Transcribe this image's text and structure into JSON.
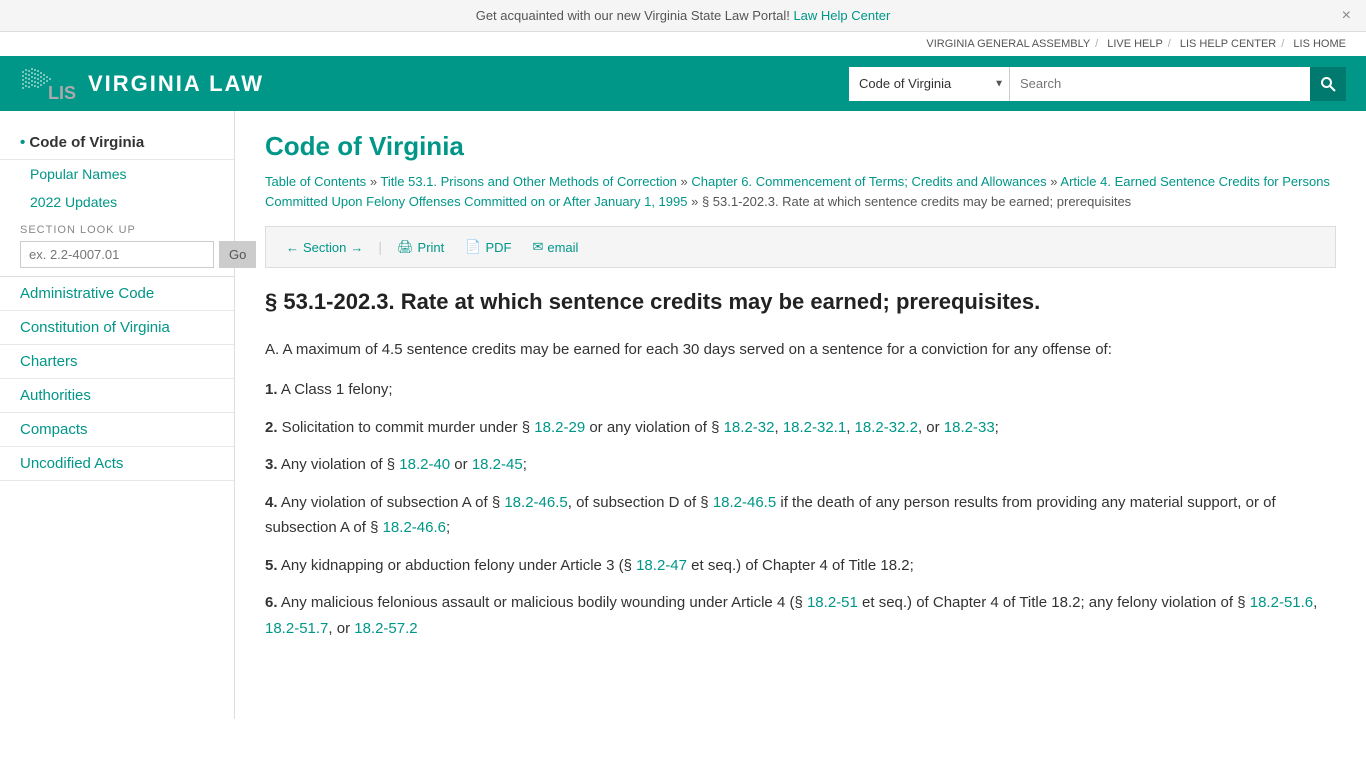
{
  "banner": {
    "text": "Get acquainted with our new Virginia State Law Portal!",
    "link_label": "Law Help Center",
    "link_href": "#",
    "close_label": "×"
  },
  "top_nav": {
    "items": [
      {
        "label": "VIRGINIA GENERAL ASSEMBLY",
        "href": "#"
      },
      {
        "label": "LIVE HELP",
        "href": "#"
      },
      {
        "label": "LIS HELP CENTER",
        "href": "#"
      },
      {
        "label": "LIS HOME",
        "href": "#"
      }
    ]
  },
  "header": {
    "site_title": "VIRGINIA LAW",
    "search_dropdown_value": "Code of Virginia",
    "search_dropdown_options": [
      "Code of Virginia",
      "Administrative Code",
      "Constitution of Virginia",
      "Charters",
      "Authorities",
      "Compacts",
      "Uncodified Acts"
    ],
    "search_placeholder": "Search"
  },
  "sidebar": {
    "items": [
      {
        "label": "Code of Virginia",
        "active": true,
        "href": "#"
      },
      {
        "label": "Popular Names",
        "sub": true,
        "href": "#"
      },
      {
        "label": "2022 Updates",
        "sub": true,
        "href": "#"
      },
      {
        "label": "Administrative Code",
        "href": "#"
      },
      {
        "label": "Constitution of Virginia",
        "href": "#"
      },
      {
        "label": "Charters",
        "href": "#"
      },
      {
        "label": "Authorities",
        "href": "#"
      },
      {
        "label": "Compacts",
        "href": "#"
      },
      {
        "label": "Uncodified Acts",
        "href": "#"
      }
    ],
    "section_lookup": {
      "label": "SECTION LOOK UP",
      "placeholder": "ex. 2.2-4007.01",
      "button_label": "Go"
    }
  },
  "main": {
    "heading": "Code of Virginia",
    "breadcrumb": [
      {
        "label": "Table of Contents",
        "href": "#"
      },
      {
        "label": "Title 53.1. Prisons and Other Methods of Correction",
        "href": "#"
      },
      {
        "label": "Chapter 6. Commencement of Terms; Credits and Allowances",
        "href": "#"
      },
      {
        "label": "Article 4. Earned Sentence Credits for Persons Committed Upon Felony Offenses Committed on or After January 1, 1995",
        "href": "#"
      },
      {
        "label": "§ 53.1-202.3. Rate at which sentence credits may be earned; prerequisites",
        "href": "#"
      }
    ],
    "toolbar": {
      "section_label": "Section",
      "print_label": "Print",
      "pdf_label": "PDF",
      "email_label": "email"
    },
    "section_title": "§ 53.1-202.3. Rate at which sentence credits may be earned; prerequisites.",
    "content": {
      "intro": "A. A maximum of 4.5 sentence credits may be earned for each 30 days served on a sentence for a conviction for any offense of:",
      "items": [
        {
          "number": "1.",
          "text": "A Class 1 felony;"
        },
        {
          "number": "2.",
          "text": "Solicitation to commit murder under § ",
          "links": [
            {
              "label": "18.2-29",
              "href": "#"
            }
          ],
          "text2": " or any violation of § ",
          "links2": [
            {
              "label": "18.2-32",
              "href": "#"
            },
            {
              "label": "18.2-32.1",
              "href": "#"
            },
            {
              "label": "18.2-32.2",
              "href": "#"
            },
            {
              "label": "18.2-33",
              "href": "#"
            }
          ],
          "text3": ";"
        },
        {
          "number": "3.",
          "text": "Any violation of § ",
          "links": [
            {
              "label": "18.2-40",
              "href": "#"
            },
            {
              "label": "18.2-45",
              "href": "#"
            }
          ],
          "text2": ";"
        },
        {
          "number": "4.",
          "text": "Any violation of subsection A of § ",
          "link1": {
            "label": "18.2-46.5",
            "href": "#"
          },
          "text2": ", of subsection D of § ",
          "link2": {
            "label": "18.2-46.5",
            "href": "#"
          },
          "text3": " if the death of any person results from providing any material support, or of subsection A of § ",
          "link3": {
            "label": "18.2-46.6",
            "href": "#"
          },
          "text4": ";"
        },
        {
          "number": "5.",
          "text": "Any kidnapping or abduction felony under Article 3 (§ ",
          "link": {
            "label": "18.2-47",
            "href": "#"
          },
          "text2": " et seq.) of Chapter 4 of Title 18.2;"
        },
        {
          "number": "6.",
          "text": "Any malicious felonious assault or malicious bodily wounding under Article 4 (§ ",
          "link": {
            "label": "18.2-51",
            "href": "#"
          },
          "text2": " et seq.) of Chapter 4 of Title 18.2; any felony violation of § ",
          "links": [
            {
              "label": "18.2-51.6",
              "href": "#"
            },
            {
              "label": "18.2-51.7",
              "href": "#"
            },
            {
              "label": "18.2-57.2",
              "href": "#"
            }
          ]
        }
      ]
    }
  }
}
